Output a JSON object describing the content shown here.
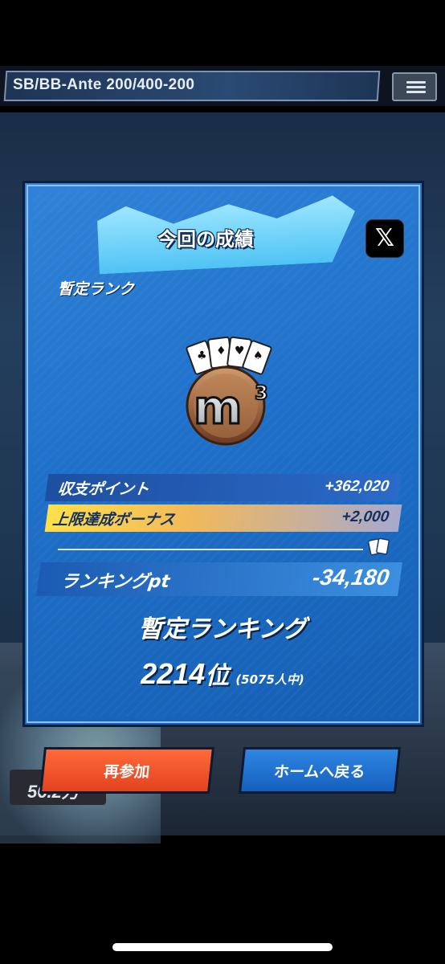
{
  "header": {
    "blind_info": "SB/BB-Ante 200/400-200"
  },
  "dialog": {
    "title": "今回の成績",
    "rank_label": "暫定ランク",
    "rank_emblem_text": "m",
    "rank_emblem_sub": "3",
    "share_icon": "x-logo-icon",
    "stats": [
      {
        "label": "収支ポイント",
        "value": "+362,020"
      },
      {
        "label": "上限達成ボーナス",
        "value": "+2,000"
      },
      {
        "label": "ランキングpt",
        "value": "-34,180"
      }
    ],
    "ranking_title": "暫定ランキング",
    "rank_position": "2214",
    "rank_unit": "位",
    "rank_total": "(5075人中)"
  },
  "buttons": {
    "rejoin": "再参加",
    "home": "ホームへ戻る"
  },
  "background": {
    "chip_text": "56.2万"
  },
  "colors": {
    "dialog_blue": "#1f70c9",
    "rejoin_orange": "#e3421e",
    "home_blue": "#155fbf",
    "bonus_yellow": "#ffe04a"
  }
}
